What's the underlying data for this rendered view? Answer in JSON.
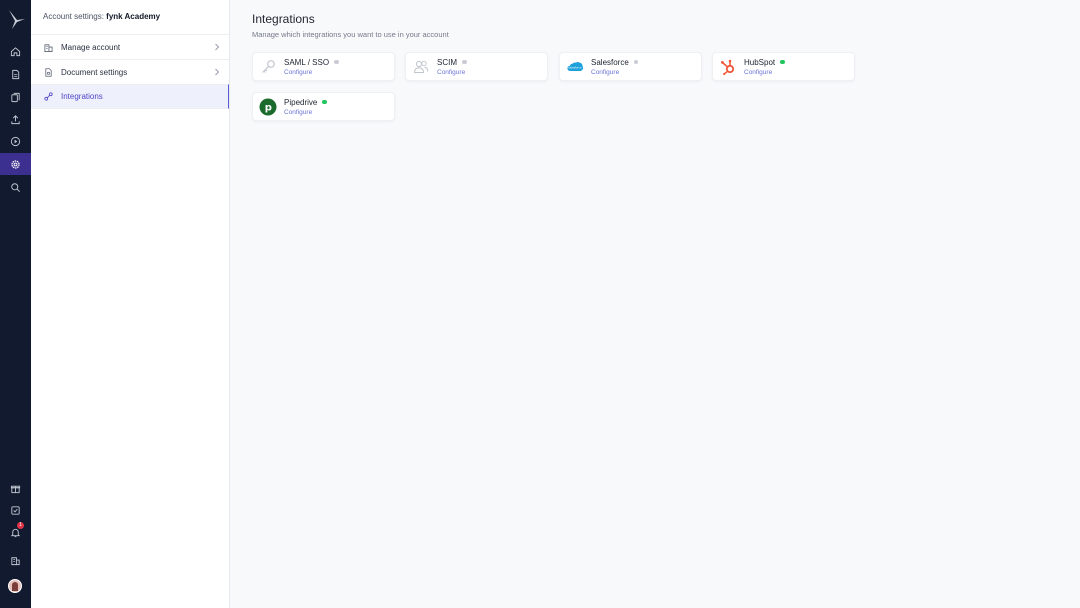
{
  "account": {
    "prefix": "Account settings: ",
    "name": "fynk Academy"
  },
  "nav": {
    "items": [
      {
        "label": "Manage account",
        "icon": "building-icon"
      },
      {
        "label": "Document settings",
        "icon": "document-gear-icon"
      },
      {
        "label": "Integrations",
        "icon": "link-icon"
      }
    ]
  },
  "page": {
    "title": "Integrations",
    "subtitle": "Manage which integrations you want to use in your account"
  },
  "integrations": [
    {
      "name": "SAML / SSO",
      "link": "Configure",
      "status": "inactive"
    },
    {
      "name": "SCIM",
      "link": "Configure",
      "status": "inactive"
    },
    {
      "name": "Salesforce",
      "link": "Configure",
      "status": "inactive",
      "logo_text": "salesforce"
    },
    {
      "name": "HubSpot",
      "link": "Configure",
      "status": "active"
    },
    {
      "name": "Pipedrive",
      "link": "Configure",
      "status": "active",
      "logo_text": "p"
    }
  ],
  "notifications": {
    "count": "1"
  },
  "colors": {
    "rail_bg": "#111a2e",
    "rail_active": "#3b2f8f",
    "accent": "#5b5bd6",
    "status_active": "#22c55e",
    "status_inactive": "#c9ccd3",
    "salesforce": "#1ea0db",
    "hubspot": "#f2563a",
    "pipedrive": "#1a6b2c"
  }
}
